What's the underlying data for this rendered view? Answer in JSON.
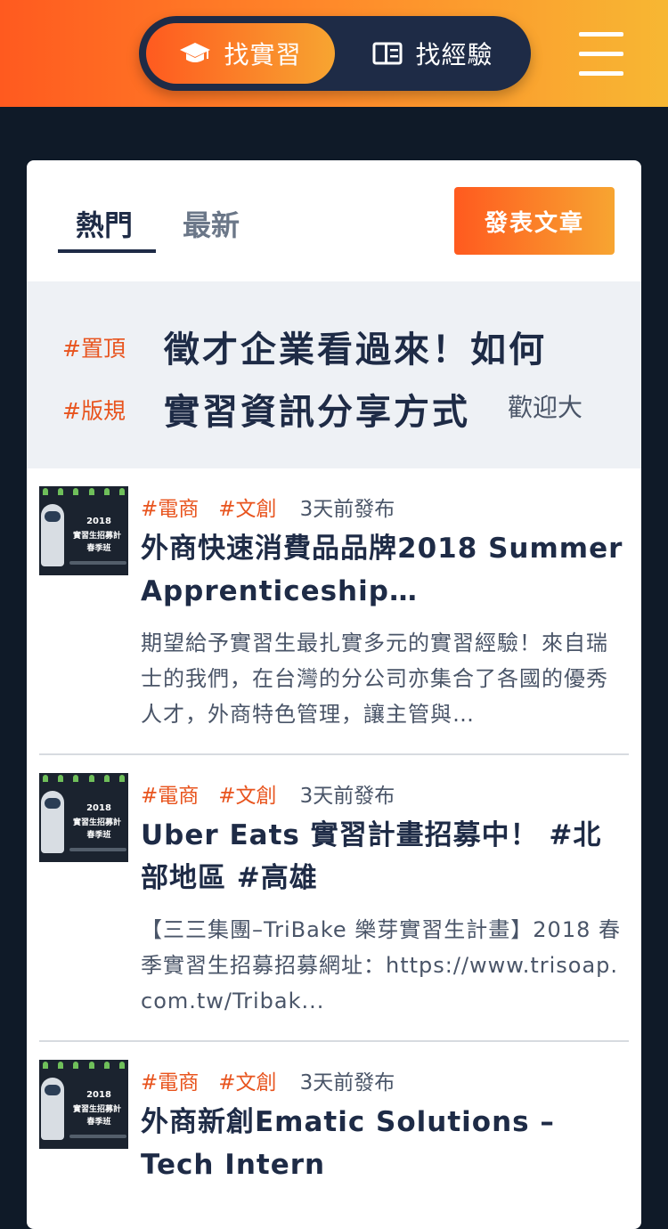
{
  "header": {
    "tabs": [
      {
        "label": "找實習",
        "icon": "graduation-cap-icon",
        "active": true
      },
      {
        "label": "找經驗",
        "icon": "book-open-icon",
        "active": false
      }
    ],
    "menu_icon": "hamburger-menu-icon",
    "colors": {
      "accent_start": "#ff5a1f",
      "accent_end": "#f7b733",
      "navy": "#1e2b46"
    }
  },
  "feed": {
    "tabs": [
      {
        "label": "熱門",
        "active": true
      },
      {
        "label": "最新",
        "active": false
      }
    ],
    "post_button": "發表文章"
  },
  "pinned": {
    "tags": [
      "#置頂",
      "#版規"
    ],
    "title_line1": "徵才企業看過來！如何",
    "title_line2": "實習資訊分享方式",
    "desc": "歡迎大"
  },
  "thumbnail": {
    "year": "2018",
    "line1": "實習生招募計",
    "line2": "春季班"
  },
  "articles": [
    {
      "tags": [
        "#電商",
        "#文創"
      ],
      "date": "3天前發布",
      "title": "外商快速消費品品牌2018 Summer Apprenticeship…",
      "desc": "期望給予實習生最扎實多元的實習經驗！來自瑞士的我們，在台灣的分公司亦集合了各國的優秀人才，外商特色管理，讓主管與…"
    },
    {
      "tags": [
        "#電商",
        "#文創"
      ],
      "date": "3天前發布",
      "title": "Uber Eats 實習計畫招募中！ #北部地區 #高雄",
      "desc": "【三三集團–TriBake 樂芽實習生計畫】2018 春季實習生招募招募網址：https://www.trisoap.com.tw/Tribak..."
    },
    {
      "tags": [
        "#電商",
        "#文創"
      ],
      "date": "3天前發布",
      "title": "外商新創Ematic Solutions – Tech Intern",
      "desc": ""
    }
  ]
}
